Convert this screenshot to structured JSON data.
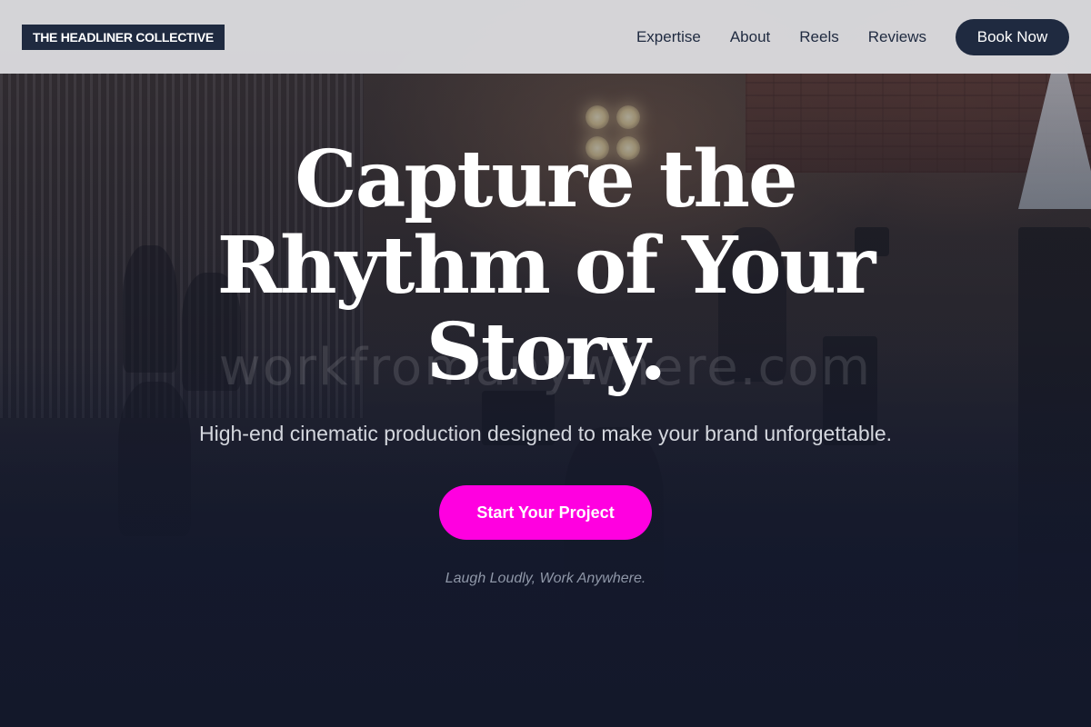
{
  "nav": {
    "logo": "THE HEADLINER COLLECTIVE",
    "links": [
      "Expertise",
      "About",
      "Reels",
      "Reviews"
    ],
    "cta": "Book Now"
  },
  "hero": {
    "title_lines": [
      "Capture the",
      "Rhythm of Your",
      "Story."
    ],
    "subtitle": "High-end cinematic production designed to make your brand unforgettable.",
    "cta": "Start Your Project",
    "tagline": "Laugh Loudly, Work Anywhere.",
    "watermark": "workfromanywhere.com"
  },
  "colors": {
    "nav_bg": "#e2e2e5",
    "brand_dark": "#1f2a40",
    "accent": "#ff00e0",
    "hero_text": "#ffffff"
  }
}
